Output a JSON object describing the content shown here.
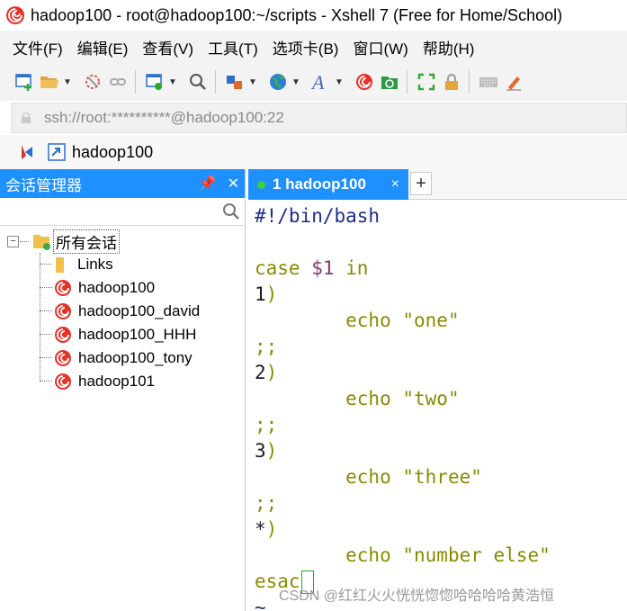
{
  "window": {
    "title": "hadoop100 - root@hadoop100:~/scripts - Xshell 7 (Free for Home/School)"
  },
  "menu": [
    {
      "label": "文件(F)"
    },
    {
      "label": "编辑(E)"
    },
    {
      "label": "查看(V)"
    },
    {
      "label": "工具(T)"
    },
    {
      "label": "选项卡(B)"
    },
    {
      "label": "窗口(W)"
    },
    {
      "label": "帮助(H)"
    }
  ],
  "address": {
    "value": "ssh://root:**********@hadoop100:22"
  },
  "session_bar": {
    "label": "hadoop100"
  },
  "session_manager": {
    "title": "会话管理器",
    "pin_icon": "pin-icon",
    "close_icon": "close-icon",
    "root_label": "所有会话",
    "items": [
      {
        "label": "Links",
        "icon": "folder-icon"
      },
      {
        "label": "hadoop100",
        "icon": "xshell-session-icon"
      },
      {
        "label": "hadoop100_david",
        "icon": "xshell-session-icon"
      },
      {
        "label": "hadoop100_HHH",
        "icon": "xshell-session-icon"
      },
      {
        "label": "hadoop100_tony",
        "icon": "xshell-session-icon"
      },
      {
        "label": "hadoop101",
        "icon": "xshell-session-icon"
      }
    ]
  },
  "tab": {
    "label": "1 hadoop100",
    "close": "×",
    "add": "+"
  },
  "terminal": {
    "lines": [
      {
        "parts": [
          {
            "t": "#!/bin/bash",
            "c": "blue"
          }
        ]
      },
      {
        "parts": [
          {
            "t": "",
            "c": "dark"
          }
        ]
      },
      {
        "parts": [
          {
            "t": "case ",
            "c": "olive"
          },
          {
            "t": "$1",
            "c": "purple"
          },
          {
            "t": " in",
            "c": "olive"
          }
        ]
      },
      {
        "parts": [
          {
            "t": "1",
            "c": "dark"
          },
          {
            "t": ")",
            "c": "olive"
          }
        ]
      },
      {
        "parts": [
          {
            "t": "        echo ",
            "c": "olive"
          },
          {
            "t": "\"one\"",
            "c": "olive"
          }
        ]
      },
      {
        "parts": [
          {
            "t": ";;",
            "c": "olive"
          }
        ]
      },
      {
        "parts": [
          {
            "t": "2",
            "c": "dark"
          },
          {
            "t": ")",
            "c": "olive"
          }
        ]
      },
      {
        "parts": [
          {
            "t": "        echo ",
            "c": "olive"
          },
          {
            "t": "\"two\"",
            "c": "olive"
          }
        ]
      },
      {
        "parts": [
          {
            "t": ";;",
            "c": "olive"
          }
        ]
      },
      {
        "parts": [
          {
            "t": "3",
            "c": "dark"
          },
          {
            "t": ")",
            "c": "olive"
          }
        ]
      },
      {
        "parts": [
          {
            "t": "        echo ",
            "c": "olive"
          },
          {
            "t": "\"three\"",
            "c": "olive"
          }
        ]
      },
      {
        "parts": [
          {
            "t": ";;",
            "c": "olive"
          }
        ]
      },
      {
        "parts": [
          {
            "t": "*",
            "c": "dark"
          },
          {
            "t": ")",
            "c": "olive"
          }
        ]
      },
      {
        "parts": [
          {
            "t": "        echo ",
            "c": "olive"
          },
          {
            "t": "\"number else\"",
            "c": "olive"
          }
        ]
      },
      {
        "parts": [
          {
            "t": "esac",
            "c": "olive"
          }
        ]
      },
      {
        "parts": [
          {
            "t": "~",
            "c": "blue"
          }
        ]
      }
    ]
  },
  "watermark": "CSDN @红红火火恍恍惚惚哈哈哈哈黄浩恒",
  "colors": {
    "accent": "#1e90ff",
    "active_dot": "#3fcf3f",
    "term_blue": "#1b2d8c",
    "term_olive": "#8a8a00"
  }
}
